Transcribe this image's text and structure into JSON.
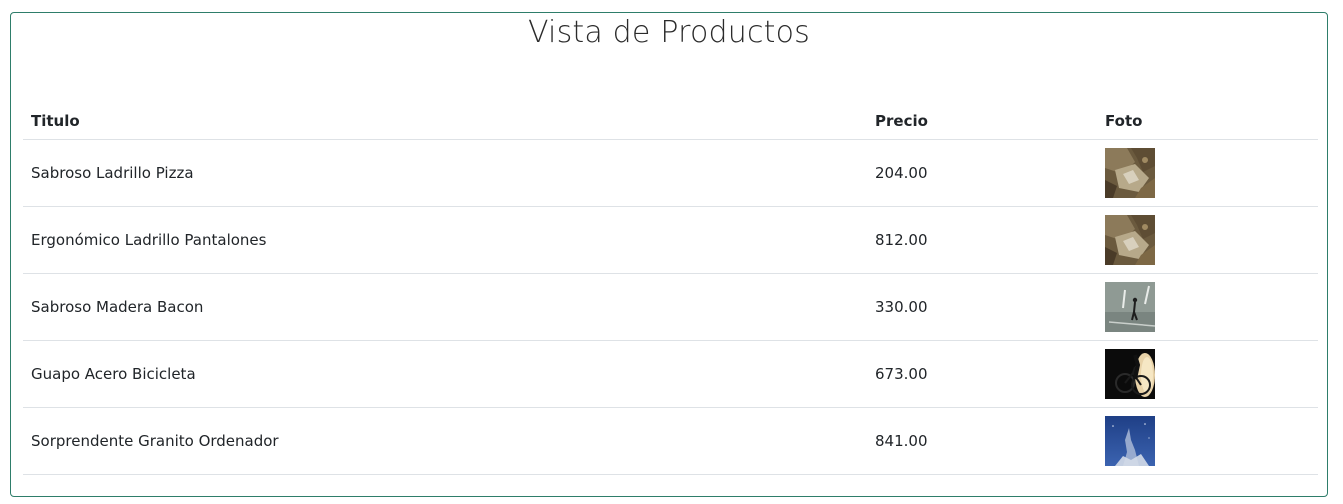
{
  "page": {
    "title": "Vista de Productos"
  },
  "table": {
    "headers": {
      "title": "Titulo",
      "price": "Precio",
      "photo": "Foto"
    },
    "rows": [
      {
        "title": "Sabroso Ladrillo Pizza",
        "price": "204.00",
        "photo_icon": "rocky-landscape-photo"
      },
      {
        "title": "Ergonómico Ladrillo Pantalones",
        "price": "812.00",
        "photo_icon": "rocky-landscape-photo"
      },
      {
        "title": "Sabroso Madera Bacon",
        "price": "330.00",
        "photo_icon": "person-walking-photo"
      },
      {
        "title": "Guapo Acero Bicicleta",
        "price": "673.00",
        "photo_icon": "bicycle-silhouette-photo"
      },
      {
        "title": "Sorprendente Granito Ordenador",
        "price": "841.00",
        "photo_icon": "blue-sky-photo"
      }
    ]
  },
  "colors": {
    "panel_border": "#2e7d6a",
    "row_border": "#dee2e6",
    "text": "#212529"
  }
}
